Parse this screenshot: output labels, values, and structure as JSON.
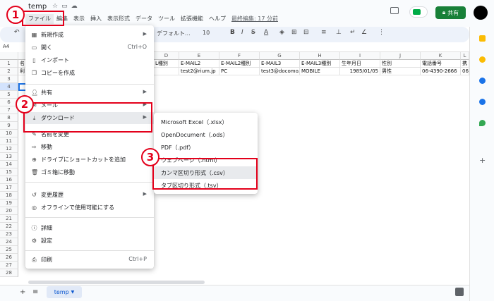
{
  "doc": {
    "title": "temp"
  },
  "menu_bar": {
    "items": [
      "ファイル",
      "編集",
      "表示",
      "挿入",
      "表示形式",
      "データ",
      "ツール",
      "拡張機能",
      "ヘルプ"
    ],
    "last_edit": "最終編集: 17 分前"
  },
  "header": {
    "share_label": "共有"
  },
  "toolbar": {
    "font": "デフォルト...",
    "size": "10"
  },
  "name_box": "A4",
  "columns": [
    "D",
    "E",
    "F",
    "G",
    "H",
    "I",
    "J",
    "K",
    "L"
  ],
  "rows": [
    "1",
    "2",
    "3",
    "4",
    "5",
    "6",
    "7",
    "8",
    "9",
    "10",
    "11",
    "12",
    "13",
    "14",
    "15",
    "16",
    "17",
    "18",
    "19",
    "20",
    "21",
    "22",
    "23",
    "24",
    "25",
    "26",
    "27",
    "28"
  ],
  "grid_cells": {
    "row1": [
      "名",
      "L種別",
      "E-MAIL2",
      "E-MAIL2種別",
      "E-MAIL3",
      "E-MAIL3種別",
      "生年月日",
      "性別",
      "電話番号",
      "携"
    ],
    "row2": [
      "利",
      "",
      "test2@rium.jp",
      "PC",
      "test3@docomo.n",
      "MOBILE",
      "1985/01/05",
      "男性",
      "06-4390-2666",
      "06"
    ]
  },
  "file_menu": {
    "new": "新規作成",
    "open": "開く",
    "open_shortcut": "Ctrl+O",
    "import": "インポート",
    "copy": "コピーを作成",
    "share": "共有",
    "email": "メール",
    "download": "ダウンロード",
    "rename": "名前を変更",
    "move": "移動",
    "shortcut": "ドライブにショートカットを追加",
    "trash": "ゴミ箱に移動",
    "history": "変更履歴",
    "offline": "オフラインで使用可能にする",
    "details": "詳細",
    "settings": "設定",
    "print": "印刷",
    "print_shortcut": "Ctrl+P"
  },
  "download_submenu": {
    "xlsx": "Microsoft Excel（.xlsx）",
    "ods": "OpenDocument（.ods）",
    "pdf": "PDF（.pdf）",
    "html": "ウェブページ（.html）",
    "csv": "カンマ区切り形式（.csv）",
    "tsv": "タブ区切り形式（.tsv）"
  },
  "annotations": {
    "step1": "1",
    "step2": "2",
    "step3": "3"
  },
  "bottom": {
    "sheet_name": "temp"
  },
  "colors": {
    "accent_red": "#e3001b",
    "share_green": "#188038",
    "sheet_tab_blue": "#0b57d0"
  }
}
